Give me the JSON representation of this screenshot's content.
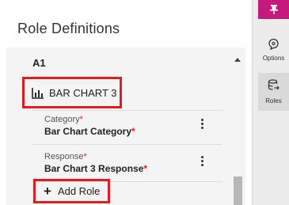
{
  "panel": {
    "title": "Role Definitions",
    "section_label": "A1",
    "chart": {
      "label": "BAR CHART 3",
      "icon": "bar-chart-icon"
    },
    "roles": [
      {
        "type": "Category",
        "name": "Bar Chart Category",
        "required_mark": "*"
      },
      {
        "type": "Response",
        "name": "Bar Chart 3 Response",
        "required_mark": "*"
      }
    ],
    "add_role": {
      "icon": "plus-icon",
      "label": "Add Role"
    }
  },
  "right_strip": {
    "pin_icon": "pin-icon",
    "items": [
      {
        "icon": "options-icon",
        "label": "Options"
      },
      {
        "icon": "roles-icon",
        "label": "Roles"
      }
    ]
  },
  "colors": {
    "highlight": "#e01b22",
    "pin_bar": "#c6197e",
    "required_star": "#e01b22"
  }
}
